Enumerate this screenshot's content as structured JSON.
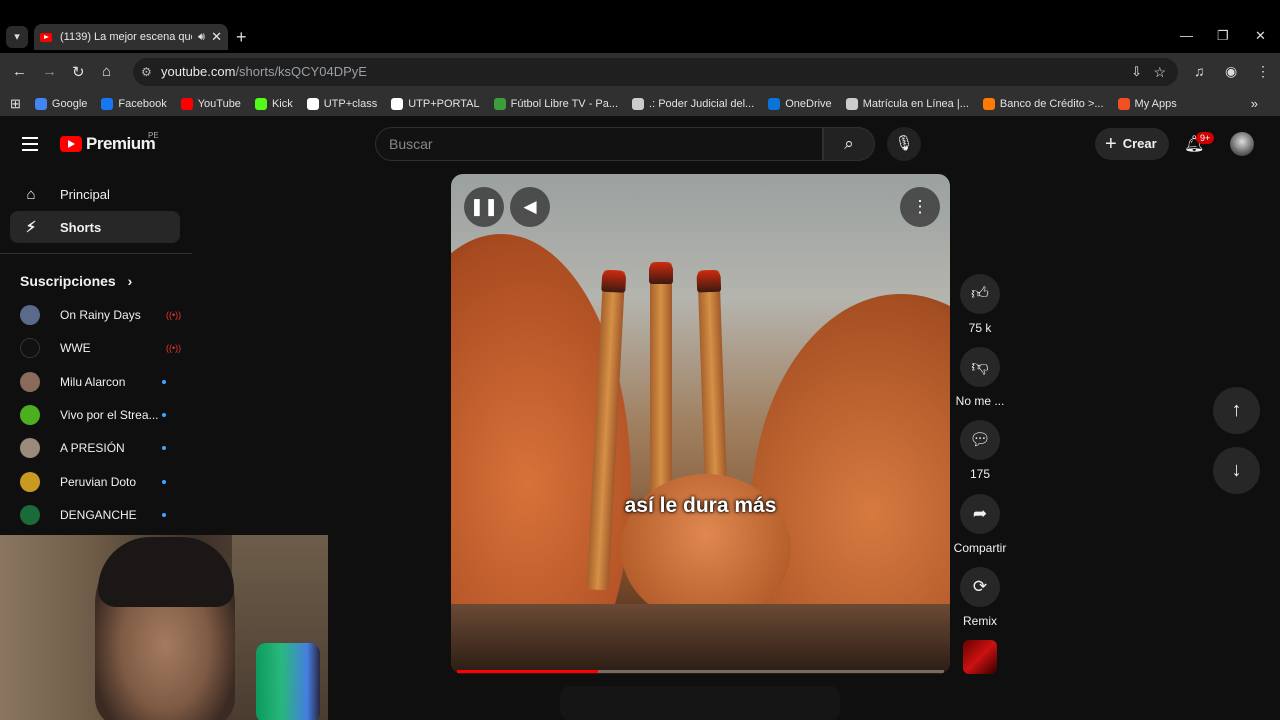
{
  "browser": {
    "tab_title": "(1139) La mejor escena que",
    "url_domain": "youtube.com",
    "url_path": "/shorts/ksQCY04DPyE",
    "bookmarks": [
      "Google",
      "Facebook",
      "YouTube",
      "Kick",
      "UTP+class",
      "UTP+PORTAL",
      "Fútbol Libre TV - Pa...",
      ".: Poder Judicial del...",
      "OneDrive",
      "Matrícula en Línea |...",
      "Banco de Crédito >...",
      "My Apps"
    ],
    "bookmark_colors": [
      "#4285f4",
      "#1877f2",
      "#ff0000",
      "#53fc18",
      "#ffffff",
      "#ffffff",
      "#3c9d3c",
      "#cccccc",
      "#0a74da",
      "#cccccc",
      "#ff7a00",
      "#f25022"
    ]
  },
  "header": {
    "logo_text": "Premium",
    "logo_region": "PE",
    "search_placeholder": "Buscar",
    "create_label": "Crear",
    "notification_count": "9+"
  },
  "sidebar": {
    "items": [
      {
        "label": "Principal",
        "icon": "home-icon"
      },
      {
        "label": "Shorts",
        "icon": "shorts-icon"
      }
    ],
    "subscriptions_title": "Suscripciones",
    "subscriptions": [
      {
        "name": "On Rainy Days",
        "status": "live",
        "avatar_color": "#5a6a8a"
      },
      {
        "name": "WWE",
        "status": "live",
        "avatar_color": "#111111"
      },
      {
        "name": "Milu Alarcon",
        "status": "new",
        "avatar_color": "#8a6a5a"
      },
      {
        "name": "Vivo por el Strea...",
        "status": "new",
        "avatar_color": "#4caf20"
      },
      {
        "name": "A PRESIÓN",
        "status": "new",
        "avatar_color": "#9a8a7a"
      },
      {
        "name": "Peruvian Doto",
        "status": "new",
        "avatar_color": "#c89a20"
      },
      {
        "name": "DENGANCHE",
        "status": "new",
        "avatar_color": "#1a6a3a"
      }
    ]
  },
  "player": {
    "caption": "así le dura más",
    "progress": 0.29
  },
  "actions": {
    "likes": "75 k",
    "dislike_label": "No me ...",
    "comments": "175",
    "share_label": "Compartir",
    "remix_label": "Remix"
  }
}
